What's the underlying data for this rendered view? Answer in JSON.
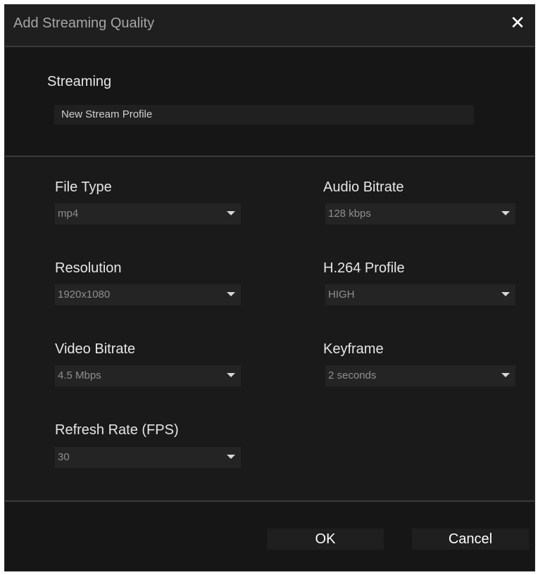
{
  "dialog": {
    "title": "Add Streaming Quality",
    "close_icon": "close-icon"
  },
  "streaming": {
    "label": "Streaming",
    "value": "New Stream Profile"
  },
  "fields": {
    "file_type": {
      "label": "File Type",
      "value": "mp4"
    },
    "audio_bitrate": {
      "label": "Audio Bitrate",
      "value": "128 kbps"
    },
    "resolution": {
      "label": "Resolution",
      "value": "1920x1080"
    },
    "h264_profile": {
      "label": "H.264 Profile",
      "value": "HIGH"
    },
    "video_bitrate": {
      "label": "Video Bitrate",
      "value": "4.5 Mbps"
    },
    "keyframe": {
      "label": "Keyframe",
      "value": "2 seconds"
    },
    "refresh_rate": {
      "label": "Refresh Rate (FPS)",
      "value": "30"
    }
  },
  "footer": {
    "ok_label": "OK",
    "cancel_label": "Cancel"
  },
  "icons": {
    "dropdown": "chevron-down-icon"
  }
}
